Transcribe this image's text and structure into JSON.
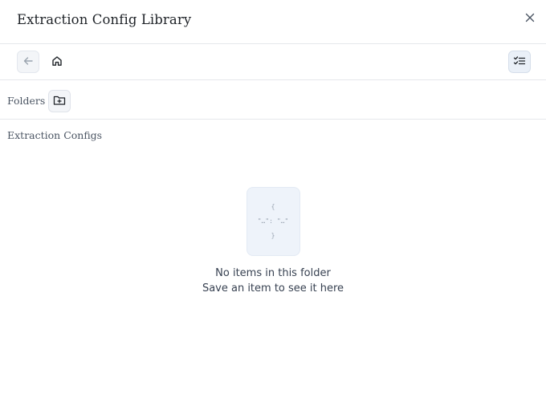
{
  "dialog": {
    "title": "Extraction Config Library",
    "close_icon": "close-icon"
  },
  "toolbar": {
    "back_icon": "arrow-left-icon",
    "home_icon": "home-icon",
    "select_icon": "checklist-icon"
  },
  "folders": {
    "label": "Folders",
    "new_folder_icon": "folder-plus-icon"
  },
  "configs": {
    "label": "Extraction Configs"
  },
  "empty_state": {
    "glyph_line_1": "{",
    "glyph_line_2": "\"…\": \"…\"",
    "glyph_line_3": "}",
    "title": "No items in this folder",
    "subtitle": "Save an item to see it here"
  },
  "colors": {
    "border": "#e5e7eb",
    "button_bg": "#f3f5f8",
    "active_button_bg": "#eaf0f8",
    "empty_card_bg": "#eef3fa"
  }
}
